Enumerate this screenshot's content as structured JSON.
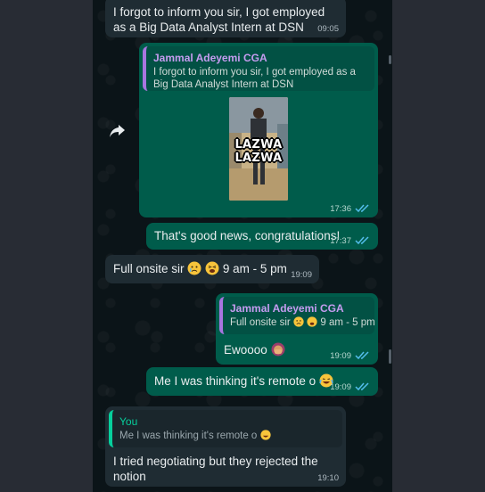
{
  "messages": {
    "m1": {
      "text": "I forgot to inform you sir, I got employed as a Big Data Analyst Intern at DSN",
      "time": "09:05"
    },
    "m2": {
      "quote_name": "Jammal Adeyemi CGA",
      "quote_text": "I forgot to inform you sir, I got employed as a Big Data Analyst Intern at DSN",
      "sticker_caption": "LAZWA LAZWA",
      "time": "17:36"
    },
    "m3": {
      "text": "That's good news, congratulations!",
      "time": "17:37"
    },
    "m4": {
      "text_before": "Full onsite sir",
      "text_after": "9 am - 5 pm",
      "time": "19:09"
    },
    "m5": {
      "quote_name": "Jammal Adeyemi CGA",
      "quote_text_before": "Full onsite sir",
      "quote_text_after": "9 am - 5 pm",
      "text": "Ewoooo",
      "time": "19:09"
    },
    "m6": {
      "text": "Me I was thinking it's remote o",
      "time": "19:09"
    },
    "m7": {
      "quote_name": "You",
      "quote_text": "Me I was thinking it's remote o",
      "text": "I tried negotiating but they rejected the notion",
      "time": "19:10"
    }
  },
  "colors": {
    "incoming": "#1f2c33",
    "outgoing": "#005c4b",
    "read_ticks": "#53bdeb",
    "reply_accent": "#06cf9c"
  },
  "icons": [
    "forward-icon",
    "double-check-icon",
    "crying-face-emoji",
    "tired-face-emoji",
    "face-palm-emoji",
    "laughing-emoji"
  ]
}
